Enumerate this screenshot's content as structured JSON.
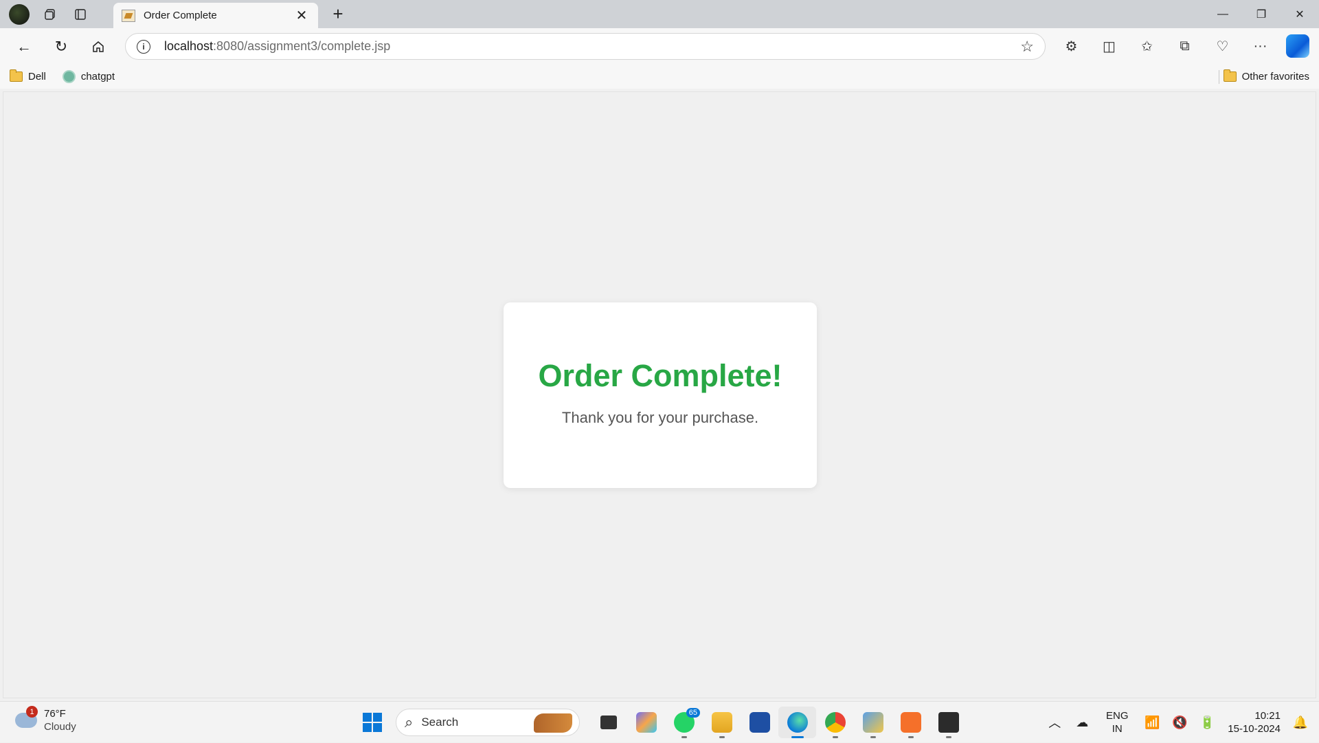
{
  "browser": {
    "tab_title": "Order Complete",
    "url_host": "localhost",
    "url_rest": ":8080/assignment3/complete.jsp"
  },
  "bookmarks": {
    "items": [
      "Dell",
      "chatgpt"
    ],
    "other": "Other favorites"
  },
  "page": {
    "heading": "Order Complete!",
    "message": "Thank you for your purchase.",
    "heading_color": "#28a745"
  },
  "taskbar": {
    "weather_temp": "76°F",
    "weather_cond": "Cloudy",
    "weather_badge": "1",
    "search_label": "Search",
    "whatsapp_badge": "65",
    "lang_line1": "ENG",
    "lang_line2": "IN",
    "time": "10:21",
    "date": "15-10-2024"
  }
}
